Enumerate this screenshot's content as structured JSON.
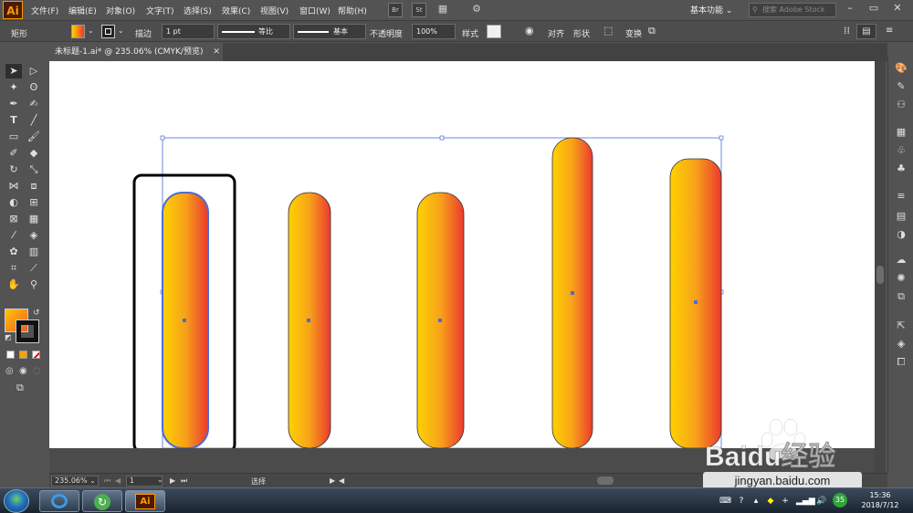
{
  "app": {
    "logo": "Ai",
    "menus": [
      "文件(F)",
      "编辑(E)",
      "对象(O)",
      "文字(T)",
      "选择(S)",
      "效果(C)",
      "视图(V)",
      "窗口(W)",
      "帮助(H)"
    ],
    "bridge_label": "Br",
    "stock_label": "St",
    "workspace": "基本功能",
    "search_placeholder": "搜索 Adobe Stock"
  },
  "control_bar": {
    "object_type": "矩形",
    "stroke_label": "描边",
    "stroke_weight": "1 pt",
    "profile_label": "等比",
    "brush_label": "基本",
    "opacity_label": "不透明度",
    "opacity_value": "100%",
    "style_label": "样式",
    "align_label": "对齐",
    "shape_label": "形状",
    "transform_label": "变换"
  },
  "document": {
    "tab_title": "未标题-1.ai* @ 235.06% (CMYK/预览)"
  },
  "status_bar": {
    "zoom": "235.06%",
    "artboard": "1",
    "tool_name": "选择"
  },
  "taskbar": {
    "active_app_label": "Ai",
    "time": "15:36",
    "date": "2018/7/12",
    "badge_number": "35"
  },
  "watermark": {
    "logo_text": "Baidu经验",
    "url": "jingyan.baidu.com"
  },
  "colors": {
    "gradient_start": "#ffd200",
    "gradient_mid": "#f7a21a",
    "gradient_end": "#eb3a2e",
    "selection_blue": "#4b6cd6"
  },
  "bars": [
    {
      "name": "bar-1",
      "selected": true
    },
    {
      "name": "bar-2",
      "selected": false
    },
    {
      "name": "bar-3",
      "selected": false
    },
    {
      "name": "bar-4",
      "selected": false
    },
    {
      "name": "bar-5",
      "selected": false
    }
  ]
}
